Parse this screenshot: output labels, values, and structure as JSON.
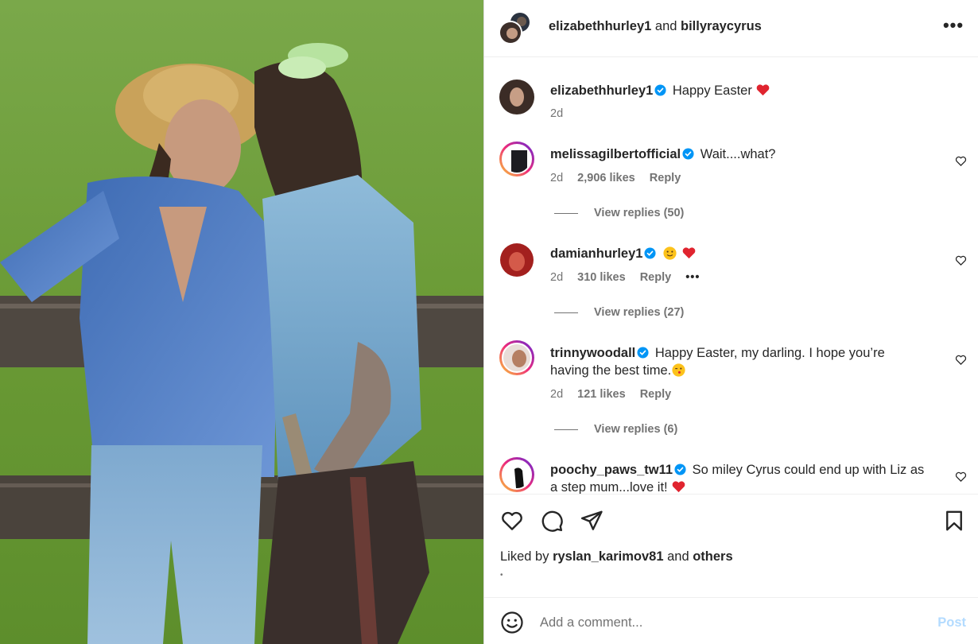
{
  "post": {
    "image_alt": "Couple in a sunny field leaning on a wooden fence"
  },
  "header": {
    "user1": "elizabethhurley1",
    "and": "and",
    "user2": "billyraycyrus"
  },
  "caption": {
    "username": "elizabethhurley1",
    "text": "Happy Easter",
    "time": "2d"
  },
  "comments": [
    {
      "username": "melissagilbertofficial",
      "text": "Wait....what?",
      "time": "2d",
      "likes": "2,906 likes",
      "reply": "Reply",
      "view_replies": "View replies (50)"
    },
    {
      "username": "damianhurley1",
      "text": "",
      "time": "2d",
      "likes": "310 likes",
      "reply": "Reply",
      "more": "•••",
      "view_replies": "View replies (27)"
    },
    {
      "username": "trinnywoodall",
      "text_line1": "Happy Easter, my darling. I hope you’re",
      "text_line2": "having the best time.",
      "time": "2d",
      "likes": "121 likes",
      "reply": "Reply",
      "view_replies": "View replies (6)"
    },
    {
      "username": "poochy_paws_tw11",
      "text_line1": "So miley Cyrus could end up with Liz as",
      "text_line2": "a step mum...love it!"
    }
  ],
  "likes_line": {
    "prefix": "Liked by",
    "user": "ryslan_karimov81",
    "and": "and",
    "others": "others"
  },
  "add_comment": {
    "placeholder": "Add a comment...",
    "post_label": "Post"
  },
  "colors": {
    "verified": "#0095f6",
    "heart_red": "#ff3040",
    "post_disabled": "#b3dbff"
  }
}
